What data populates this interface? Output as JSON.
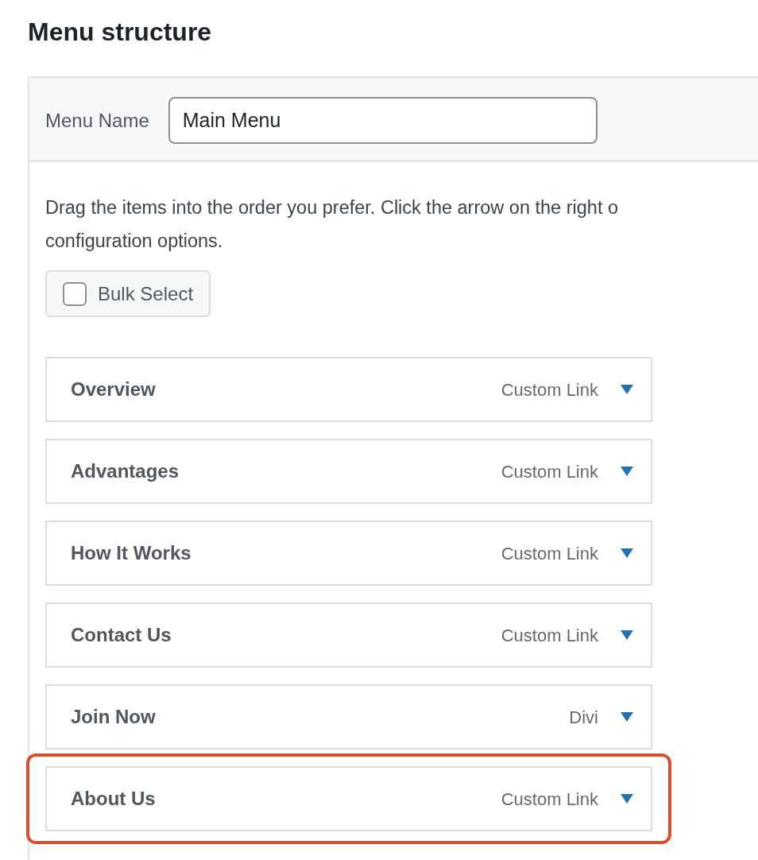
{
  "heading": "Menu structure",
  "menu_name": {
    "label": "Menu Name",
    "value": "Main Menu"
  },
  "instructions": [
    "Drag the items into the order you prefer. Click the arrow on the right o",
    "configuration options."
  ],
  "bulk_select": {
    "label": "Bulk Select",
    "checked": false
  },
  "items": [
    {
      "title": "Overview",
      "type": "Custom Link",
      "highlighted": false
    },
    {
      "title": "Advantages",
      "type": "Custom Link",
      "highlighted": false
    },
    {
      "title": "How It Works",
      "type": "Custom Link",
      "highlighted": false
    },
    {
      "title": "Contact Us",
      "type": "Custom Link",
      "highlighted": false
    },
    {
      "title": "Join Now",
      "type": "Divi",
      "highlighted": false
    },
    {
      "title": "About Us",
      "type": "Custom Link",
      "highlighted": true
    }
  ]
}
